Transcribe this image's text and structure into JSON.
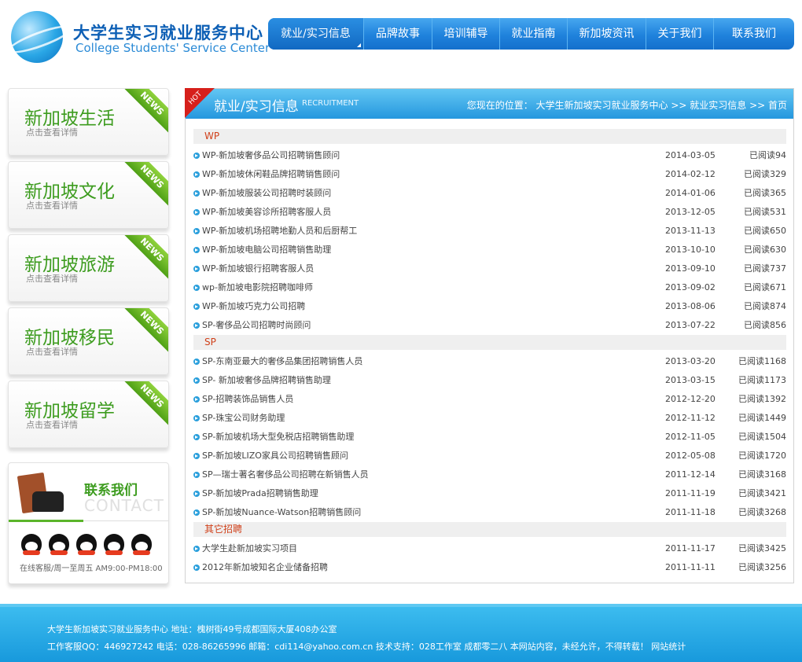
{
  "header": {
    "logo_cn": "大学生实习就业服务中心",
    "logo_en": "College Students' Service Center",
    "nav": [
      "就业/实习信息",
      "品牌故事",
      "培训辅导",
      "就业指南",
      "新加坡资讯",
      "关于我们",
      "联系我们"
    ]
  },
  "sidebar": {
    "cards": [
      {
        "title": "新加坡生活",
        "sub": "点击查看详情",
        "badge": "NEWS"
      },
      {
        "title": "新加坡文化",
        "sub": "点击查看详情",
        "badge": "NEWS"
      },
      {
        "title": "新加坡旅游",
        "sub": "点击查看详情",
        "badge": "NEWS"
      },
      {
        "title": "新加坡移民",
        "sub": "点击查看详情",
        "badge": "NEWS"
      },
      {
        "title": "新加坡留学",
        "sub": "点击查看详情",
        "badge": "NEWS"
      }
    ],
    "contact": {
      "title_cn": "联系我们",
      "title_en": "CONTACT",
      "hours": "在线客服/周一至周五 AM9:00-PM18:00"
    }
  },
  "main": {
    "hot": "HOT",
    "title": "就业/实习信息",
    "subtitle": "RECRUITMENT",
    "breadcrumb": "您现在的位置： 大学生新加坡实习就业服务中心 >> 就业实习信息 >> 首页",
    "sections": [
      {
        "name": "WP",
        "items": [
          {
            "title": "WP-新加坡奢侈品公司招聘销售顾问",
            "date": "2014-03-05",
            "read": "已阅读94"
          },
          {
            "title": "WP-新加坡休闲鞋品牌招聘销售顾问",
            "date": "2014-02-12",
            "read": "已阅读329"
          },
          {
            "title": "WP-新加坡服装公司招聘时装顾问",
            "date": "2014-01-06",
            "read": "已阅读365"
          },
          {
            "title": "WP-新加坡美容诊所招聘客服人员",
            "date": "2013-12-05",
            "read": "已阅读531"
          },
          {
            "title": "WP-新加坡机场招聘地勤人员和后厨帮工",
            "date": "2013-11-13",
            "read": "已阅读650"
          },
          {
            "title": "WP-新加坡电脑公司招聘销售助理",
            "date": "2013-10-10",
            "read": "已阅读630"
          },
          {
            "title": "WP-新加坡银行招聘客服人员",
            "date": "2013-09-10",
            "read": "已阅读737"
          },
          {
            "title": "wp-新加坡电影院招聘咖啡师",
            "date": "2013-09-02",
            "read": "已阅读671"
          },
          {
            "title": "WP-新加坡巧克力公司招聘",
            "date": "2013-08-06",
            "read": "已阅读874"
          },
          {
            "title": "SP-奢侈品公司招聘时尚顾问",
            "date": "2013-07-22",
            "read": "已阅读856"
          }
        ]
      },
      {
        "name": "SP",
        "items": [
          {
            "title": "SP-东南亚最大的奢侈品集团招聘销售人员",
            "date": "2013-03-20",
            "read": "已阅读1168"
          },
          {
            "title": "SP- 新加坡奢侈品牌招聘销售助理",
            "date": "2013-03-15",
            "read": "已阅读1173"
          },
          {
            "title": "SP-招聘装饰品销售人员",
            "date": "2012-12-20",
            "read": "已阅读1392"
          },
          {
            "title": "SP-珠宝公司财务助理",
            "date": "2012-11-12",
            "read": "已阅读1449"
          },
          {
            "title": "SP-新加坡机场大型免税店招聘销售助理",
            "date": "2012-11-05",
            "read": "已阅读1504"
          },
          {
            "title": "SP-新加坡LIZO家具公司招聘销售顾问",
            "date": "2012-05-08",
            "read": "已阅读1720"
          },
          {
            "title": "SP—瑞士著名奢侈品公司招聘在新销售人员",
            "date": "2011-12-14",
            "read": "已阅读3168"
          },
          {
            "title": "SP-新加坡Prada招聘销售助理",
            "date": "2011-11-19",
            "read": "已阅读3421"
          },
          {
            "title": "SP-新加坡Nuance-Watson招聘销售顾问",
            "date": "2011-11-18",
            "read": "已阅读3268"
          }
        ]
      },
      {
        "name": "其它招聘",
        "items": [
          {
            "title": "大学生赴新加坡实习项目",
            "date": "2011-11-17",
            "read": "已阅读3425"
          },
          {
            "title": "2012年新加坡知名企业储备招聘",
            "date": "2011-11-11",
            "read": "已阅读3256"
          }
        ]
      }
    ]
  },
  "footer": {
    "line1": "大学生新加坡实习就业服务中心 地址：槐树街49号成都国际大厦408办公室",
    "line2": "工作客服QQ：446927242 电话：028-86265996 邮箱：cdi114@yahoo.com.cn 技术支持：028工作室 成都零二八 本网站内容，未经允许，不得转载！ 网站统计"
  }
}
